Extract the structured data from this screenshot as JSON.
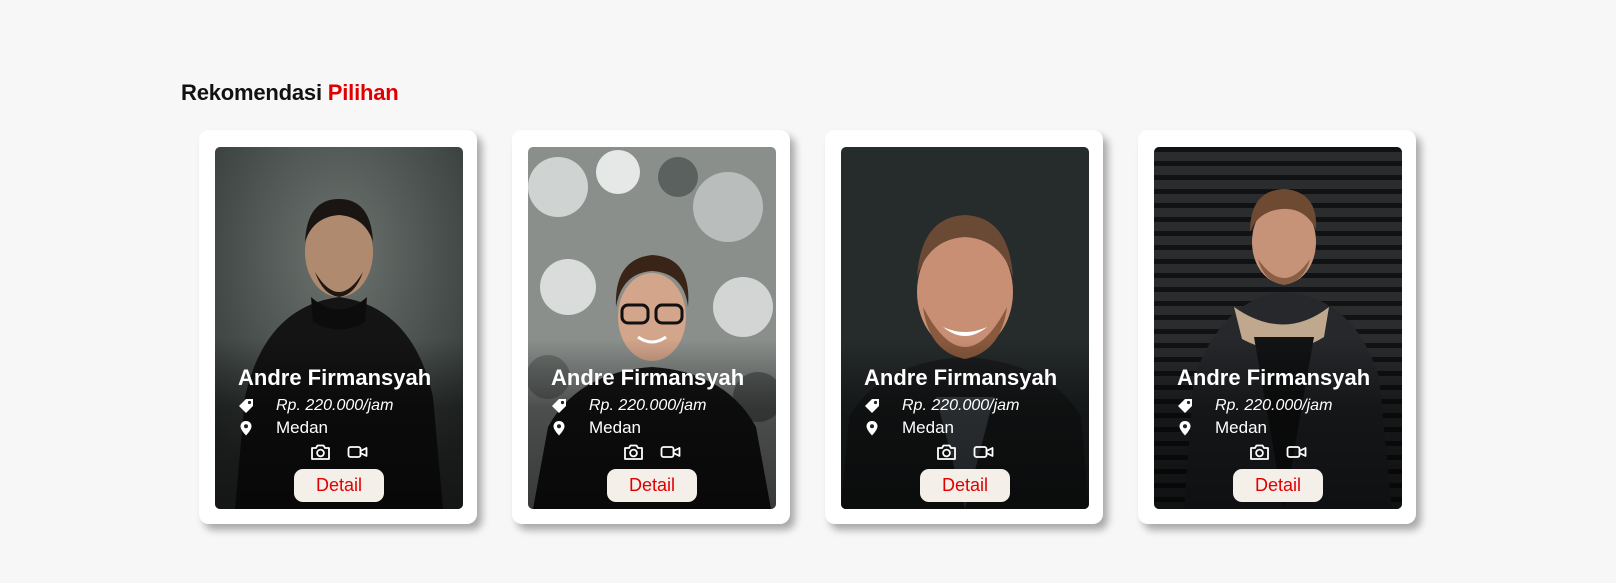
{
  "section": {
    "title_prefix": "Rekomendasi",
    "title_accent": "Pilihan"
  },
  "colors": {
    "accent": "#e00000",
    "button_bg": "#f5efe9",
    "card_bg": "#ffffff",
    "page_bg": "#f7f7f7"
  },
  "cards": [
    {
      "name": "Andre Firmansyah",
      "price": "Rp. 220.000/jam",
      "city": "Medan",
      "button": "Detail",
      "photo": "man-dark-hoodie-portrait",
      "icons": [
        "tag-icon",
        "location-pin-icon",
        "camera-icon",
        "video-icon"
      ]
    },
    {
      "name": "Andre Firmansyah",
      "price": "Rp. 220.000/jam",
      "city": "Medan",
      "button": "Detail",
      "photo": "man-glasses-snowy-trees-portrait",
      "icons": [
        "tag-icon",
        "location-pin-icon",
        "camera-icon",
        "video-icon"
      ]
    },
    {
      "name": "Andre Firmansyah",
      "price": "Rp. 220.000/jam",
      "city": "Medan",
      "button": "Detail",
      "photo": "man-smiling-beard-portrait",
      "icons": [
        "tag-icon",
        "location-pin-icon",
        "camera-icon",
        "video-icon"
      ]
    },
    {
      "name": "Andre Firmansyah",
      "price": "Rp. 220.000/jam",
      "city": "Medan",
      "button": "Detail",
      "photo": "man-denim-jacket-shutter-portrait",
      "icons": [
        "tag-icon",
        "location-pin-icon",
        "camera-icon",
        "video-icon"
      ]
    }
  ]
}
